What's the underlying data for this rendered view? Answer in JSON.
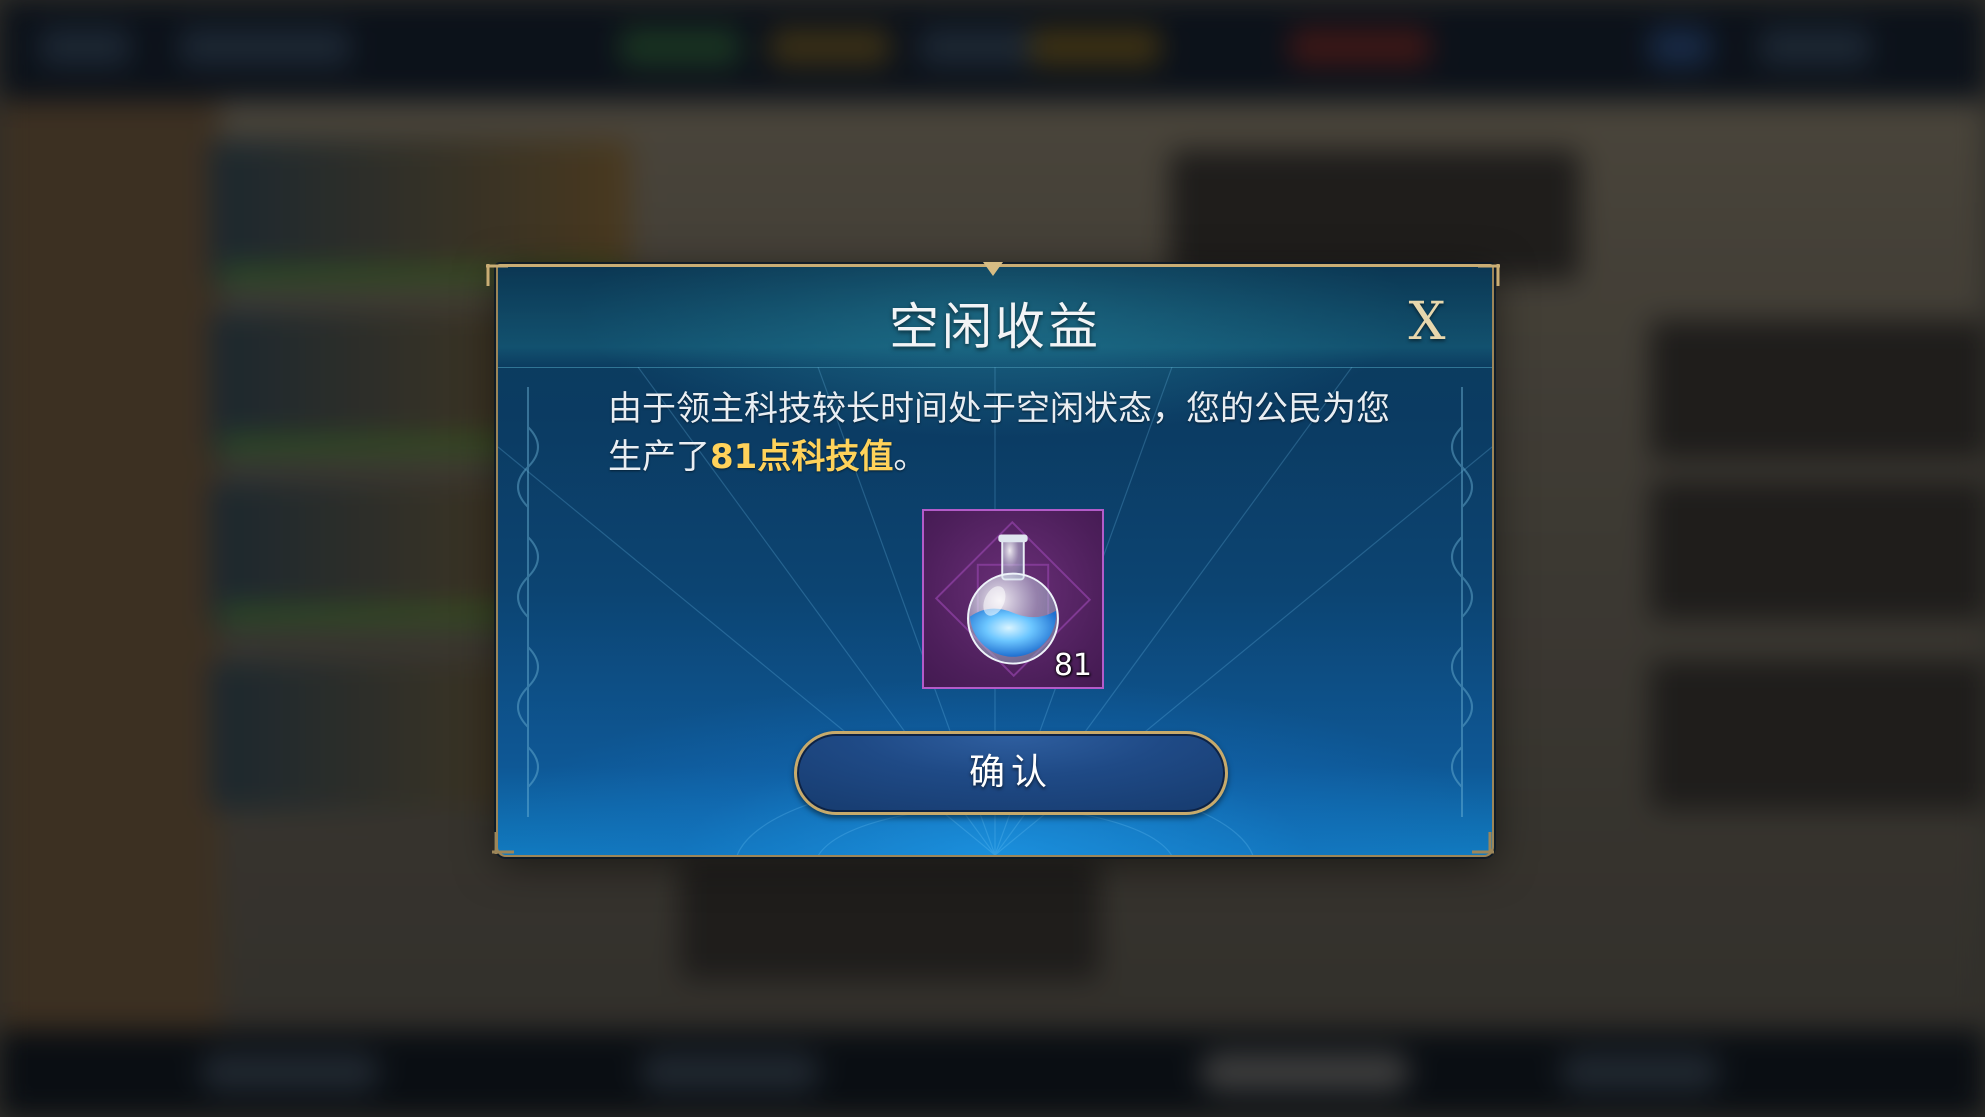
{
  "dialog": {
    "title": "空闲收益",
    "close_label": "X",
    "message_prefix": "由于领主科技较长时间处于空闲状态，您的公民为您生产了",
    "message_highlight": "81点科技值",
    "message_suffix": "。",
    "reward_item": {
      "icon": "flask-icon",
      "count": "81",
      "rarity_color": "#b35bc9"
    },
    "confirm_label": "确认"
  },
  "colors": {
    "highlight": "#ffd25a",
    "frame_gold": "#c9ad74",
    "panel_blue": "#0b3b62"
  }
}
